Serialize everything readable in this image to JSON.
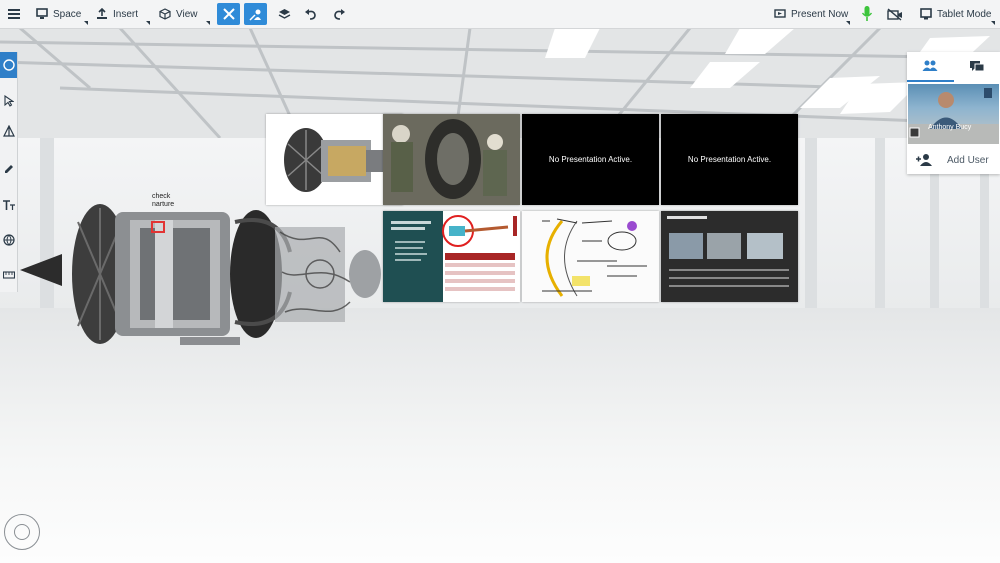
{
  "toolbar": {
    "space_label": "Space",
    "insert_label": "Insert",
    "view_label": "View",
    "present_label": "Present Now",
    "tablet_label": "Tablet Mode"
  },
  "users_panel": {
    "video_name": "Anthony Bucy",
    "add_user_label": "Add User"
  },
  "engine_annotation": "check\nnarture",
  "slides": [
    {
      "type": "image",
      "name": "engine-cutaway"
    },
    {
      "type": "image",
      "name": "engine-photo"
    },
    {
      "type": "black",
      "text": "No Presentation Active."
    },
    {
      "type": "black",
      "text": "No Presentation Active."
    },
    {
      "type": "image",
      "name": "objectives-slide",
      "title": "Objectives for Today's Meeting"
    },
    {
      "type": "image",
      "name": "equations-slide"
    },
    {
      "type": "image",
      "name": "whiteboard-slide"
    },
    {
      "type": "image",
      "name": "photos-slide",
      "title": "3D Model Bridge"
    }
  ],
  "colors": {
    "accent": "#2f8bd8",
    "toolbar_bg": "#f3f4f5",
    "mic_green": "#3cc43c"
  }
}
